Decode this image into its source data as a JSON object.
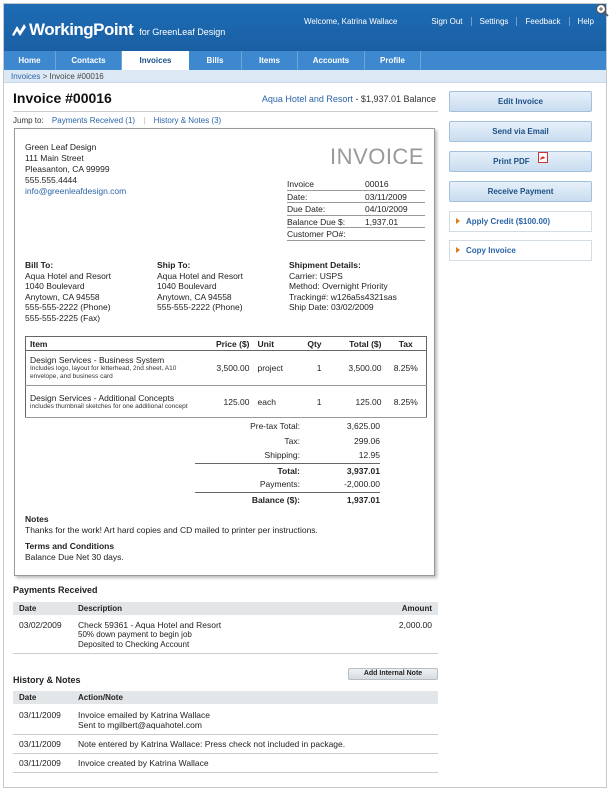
{
  "app": {
    "logo": "WorkingPoint",
    "for_text": "for GreenLeaf Design"
  },
  "toplinks": {
    "welcome": "Welcome, Katrina Wallace",
    "signout": "Sign Out",
    "settings": "Settings",
    "feedback": "Feedback",
    "help": "Help"
  },
  "nav": [
    "Home",
    "Contacts",
    "Invoices",
    "Bills",
    "Items",
    "Accounts",
    "Profile"
  ],
  "nav_active": "Invoices",
  "breadcrumb": {
    "link": "Invoices",
    "sep": " > ",
    "current": "Invoice #00016"
  },
  "header": {
    "title": "Invoice #00016",
    "customer": "Aqua Hotel and Resort",
    "balance_text": " - $1,937.01 Balance"
  },
  "jumpto": {
    "label": "Jump to:",
    "payments": "Payments Received (1)",
    "history": "History & Notes (3)",
    "sep": "|"
  },
  "company": {
    "name": "Green Leaf Design",
    "street": "111 Main Street",
    "city": "Pleasanton, CA 99999",
    "phone": "555.555.4444",
    "email": "info@greenleafdesign.com"
  },
  "invoice_label": "INVOICE",
  "meta": [
    {
      "k": "Invoice",
      "v": "00016"
    },
    {
      "k": "Date:",
      "v": "03/11/2009"
    },
    {
      "k": "Due Date:",
      "v": "04/10/2009"
    },
    {
      "k": "Balance Due $:",
      "v": "1,937.01"
    },
    {
      "k": "Customer PO#:",
      "v": ""
    }
  ],
  "bill_to": {
    "title": "Bill To:",
    "lines": [
      "Aqua Hotel and Resort",
      "1040 Boulevard",
      "Anytown, CA 94558",
      "555-555-2222 (Phone)",
      "555-555-2225 (Fax)"
    ]
  },
  "ship_to": {
    "title": "Ship To:",
    "lines": [
      "Aqua Hotel and Resort",
      "1040 Boulevard",
      "Anytown, CA 94558",
      "555-555-2222 (Phone)"
    ]
  },
  "shipment": {
    "title": "Shipment Details:",
    "lines": [
      "Carrier: USPS",
      "Method: Overnight Priority",
      "Tracking#: w126a5s4321sas",
      "Ship Date: 03/02/2009"
    ]
  },
  "items_header": {
    "item": "Item",
    "price": "Price ($)",
    "unit": "Unit",
    "qty": "Qty",
    "total": "Total ($)",
    "tax": "Tax"
  },
  "items": [
    {
      "name": "Design Services - Business System",
      "desc": "Includes logo, layout for letterhead, 2nd sheet, A10 envelope, and business card",
      "price": "3,500.00",
      "unit": "project",
      "qty": "1",
      "total": "3,500.00",
      "tax": "8.25%"
    },
    {
      "name": "Design Services - Additional Concepts",
      "desc": "includes thumbnail sketches for one additional concept",
      "price": "125.00",
      "unit": "each",
      "qty": "1",
      "total": "125.00",
      "tax": "8.25%"
    }
  ],
  "totals": {
    "pretax_k": "Pre-tax Total:",
    "pretax_v": "3,625.00",
    "tax_k": "Tax:",
    "tax_v": "299.06",
    "ship_k": "Shipping:",
    "ship_v": "12.95",
    "total_k": "Total:",
    "total_v": "3,937.01",
    "pay_k": "Payments:",
    "pay_v": "-2,000.00",
    "bal_k": "Balance ($):",
    "bal_v": "1,937.01"
  },
  "notes": {
    "title": "Notes",
    "text": "Thanks for the work! Art hard copies and CD mailed to printer per instructions.",
    "terms_title": "Terms and Conditions",
    "terms_text": "Balance Due Net 30 days."
  },
  "payments": {
    "title": "Payments Received",
    "headers": {
      "date": "Date",
      "desc": "Description",
      "amount": "Amount"
    },
    "rows": [
      {
        "date": "03/02/2009",
        "line1": "Check 59361 - Aqua Hotel and Resort",
        "line2": "50% down payment to begin job",
        "line3": "Deposited to Checking Account",
        "amount": "2,000.00"
      }
    ]
  },
  "history": {
    "title": "History & Notes",
    "add_button": "Add Internal Note",
    "headers": {
      "date": "Date",
      "action": "Action/Note"
    },
    "rows": [
      {
        "date": "03/11/2009",
        "line1": "Invoice emailed by Katrina Wallace",
        "line2": "Sent to mgilbert@aquahotel.com"
      },
      {
        "date": "03/11/2009",
        "line1": "Note entered by Katrina Wallace: Press check not included in package.",
        "line2": ""
      },
      {
        "date": "03/11/2009",
        "line1": "Invoice created by Katrina Wallace",
        "line2": ""
      }
    ]
  },
  "sidebar": {
    "edit": "Edit Invoice",
    "email": "Send via Email",
    "pdf": "Print PDF",
    "receive": "Receive Payment",
    "credit": "Apply Credit ($100.00)",
    "copy": "Copy Invoice"
  }
}
